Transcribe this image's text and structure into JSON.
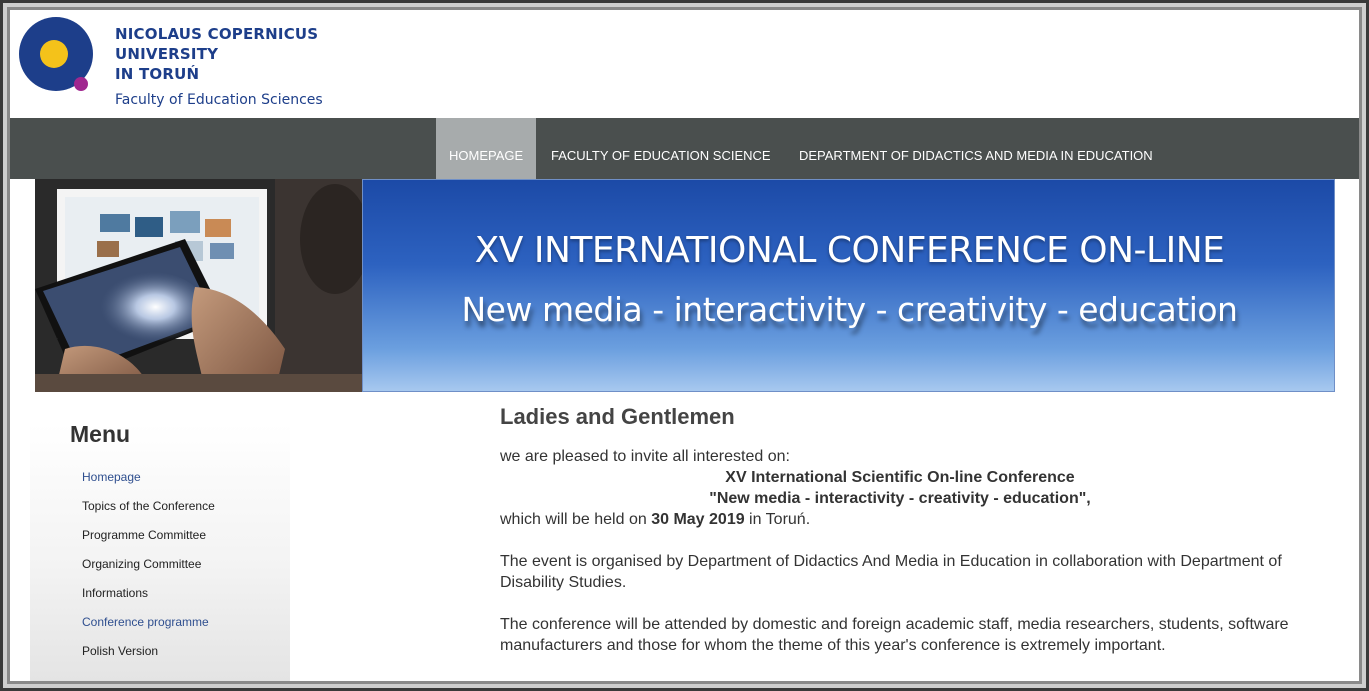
{
  "header": {
    "university_lines": [
      "NICOLAUS COPERNICUS",
      "UNIVERSITY",
      "IN TORUŃ"
    ],
    "faculty": "Faculty of Education Sciences",
    "colors": {
      "brand_blue": "#1d3e8a",
      "logo_yellow": "#f4c21a",
      "logo_purple": "#a0278f"
    }
  },
  "nav": {
    "items": [
      {
        "label": "HOMEPAGE",
        "active": true
      },
      {
        "label": "FACULTY OF EDUCATION SCIENCE",
        "active": false
      },
      {
        "label": "DEPARTMENT OF DIDACTICS AND MEDIA IN EDUCATION",
        "active": false
      }
    ]
  },
  "banner": {
    "title": "XV INTERNATIONAL CONFERENCE ON-LINE",
    "subtitle": "New media - interactivity - creativity - education"
  },
  "sidebar": {
    "title": "Menu",
    "items": [
      {
        "label": "Homepage",
        "link": true
      },
      {
        "label": "Topics of the Conference",
        "link": false
      },
      {
        "label": "Programme Committee",
        "link": false
      },
      {
        "label": "Organizing Committee",
        "link": false
      },
      {
        "label": "Informations",
        "link": false
      },
      {
        "label": "Conference programme",
        "link": true
      },
      {
        "label": "Polish Version",
        "link": false
      }
    ]
  },
  "main": {
    "heading": "Ladies and Gentlemen",
    "intro": "we are pleased to invite all interested on:",
    "conf_name": "XV International Scientific On-line Conference",
    "conf_theme": "\"New media - interactivity - creativity - education\",",
    "held_prefix": "which will be held on ",
    "held_date": "30 May 2019",
    "held_suffix": " in Toruń.",
    "para1": "The event is organised by Department of Didactics And Media in Education in collaboration with Department of Disability Studies.",
    "para2": "The conference will be attended by domestic and foreign academic staff, media researchers, students, software manufacturers and those for whom the theme of this year's conference is extremely important."
  }
}
